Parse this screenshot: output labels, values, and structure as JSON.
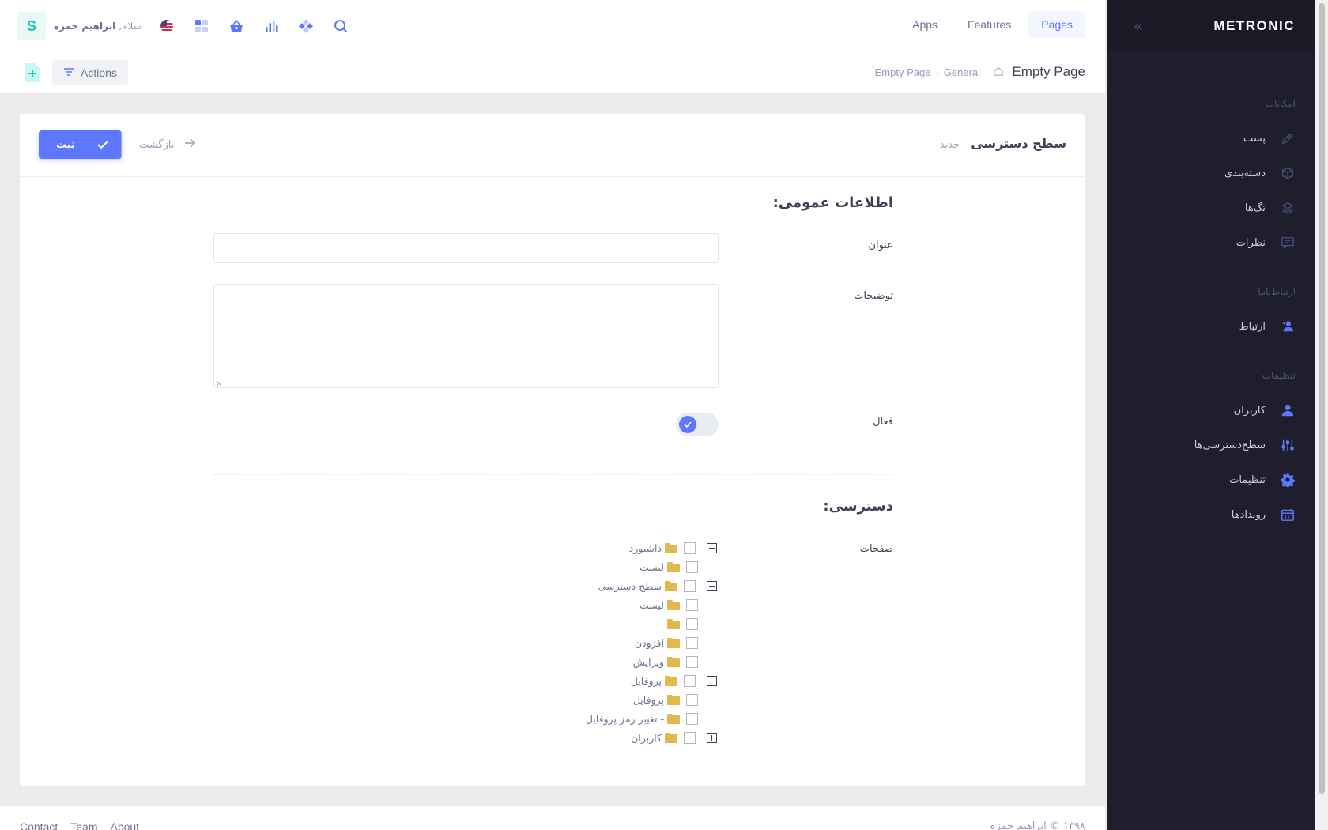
{
  "sidebar": {
    "brand": "METRONIC",
    "toggle_glyph": "«",
    "sections": [
      {
        "title": "امکانات",
        "items": [
          {
            "label": "پست",
            "icon": "pencil-icon"
          },
          {
            "label": "دسته‌بندی",
            "icon": "box-icon"
          },
          {
            "label": "تگ‌ها",
            "icon": "layers-icon"
          },
          {
            "label": "نظرات",
            "icon": "chat-icon"
          }
        ]
      },
      {
        "title": "ارتباط‌باما",
        "items": [
          {
            "label": "ارتباط",
            "icon": "add-user-icon"
          }
        ]
      },
      {
        "title": "تنظیمات",
        "items": [
          {
            "label": "کاربران",
            "icon": "user-icon"
          },
          {
            "label": "سطح‌دسترسی‌ها",
            "icon": "sliders-icon"
          },
          {
            "label": "تنظیمات",
            "icon": "gear-icon"
          },
          {
            "label": "رویدادها",
            "icon": "calendar-icon"
          }
        ]
      }
    ]
  },
  "topnav": {
    "items": [
      "Apps",
      "Features",
      "Pages"
    ],
    "active": "Pages"
  },
  "user": {
    "greeting": "سلام,",
    "name": "ابراهیم حمزه",
    "initial": "S"
  },
  "subheader": {
    "title": "Empty Page",
    "breadcrumbs": [
      "General",
      "Empty Page"
    ],
    "actions_label": "Actions"
  },
  "card": {
    "title": "سطح دسترسی",
    "subtitle": "جدید",
    "save_label": "ثبت",
    "back_label": "بازگشت"
  },
  "form": {
    "general_title": "اطلاعات عمومی:",
    "title_label": "عنوان",
    "title_value": "",
    "description_label": "توضیحات",
    "description_value": "",
    "active_label": "فعال",
    "active": true,
    "access_title": "دسترسی:",
    "pages_label": "صفحات"
  },
  "tree": [
    {
      "label": "داشبورد",
      "level": 0,
      "expander": "minus"
    },
    {
      "label": "لیست",
      "level": 1,
      "expander": "none"
    },
    {
      "label": "سطح دسترسی",
      "level": 0,
      "expander": "minus"
    },
    {
      "label": "لیست",
      "level": 1,
      "expander": "none"
    },
    {
      "label": "",
      "level": 1,
      "expander": "none"
    },
    {
      "label": "افزودن",
      "level": 1,
      "expander": "none"
    },
    {
      "label": "ویرایش",
      "level": 1,
      "expander": "none"
    },
    {
      "label": "پروفایل",
      "level": 0,
      "expander": "minus"
    },
    {
      "label": "پروفایل",
      "level": 1,
      "expander": "none"
    },
    {
      "label": "- تغییر رمز پروفایل",
      "level": 1,
      "expander": "none"
    },
    {
      "label": "کاربران",
      "level": 0,
      "expander": "plus"
    }
  ],
  "footer": {
    "links": [
      "Contact",
      "Team",
      "About"
    ],
    "copyright": "۱۳۹۸ © ابراهیم حمزه"
  },
  "colors": {
    "accent": "#5d78ff",
    "sidebar": "#1e1e2d",
    "folder": "#e0b94f",
    "success": "#1bc5bd"
  }
}
